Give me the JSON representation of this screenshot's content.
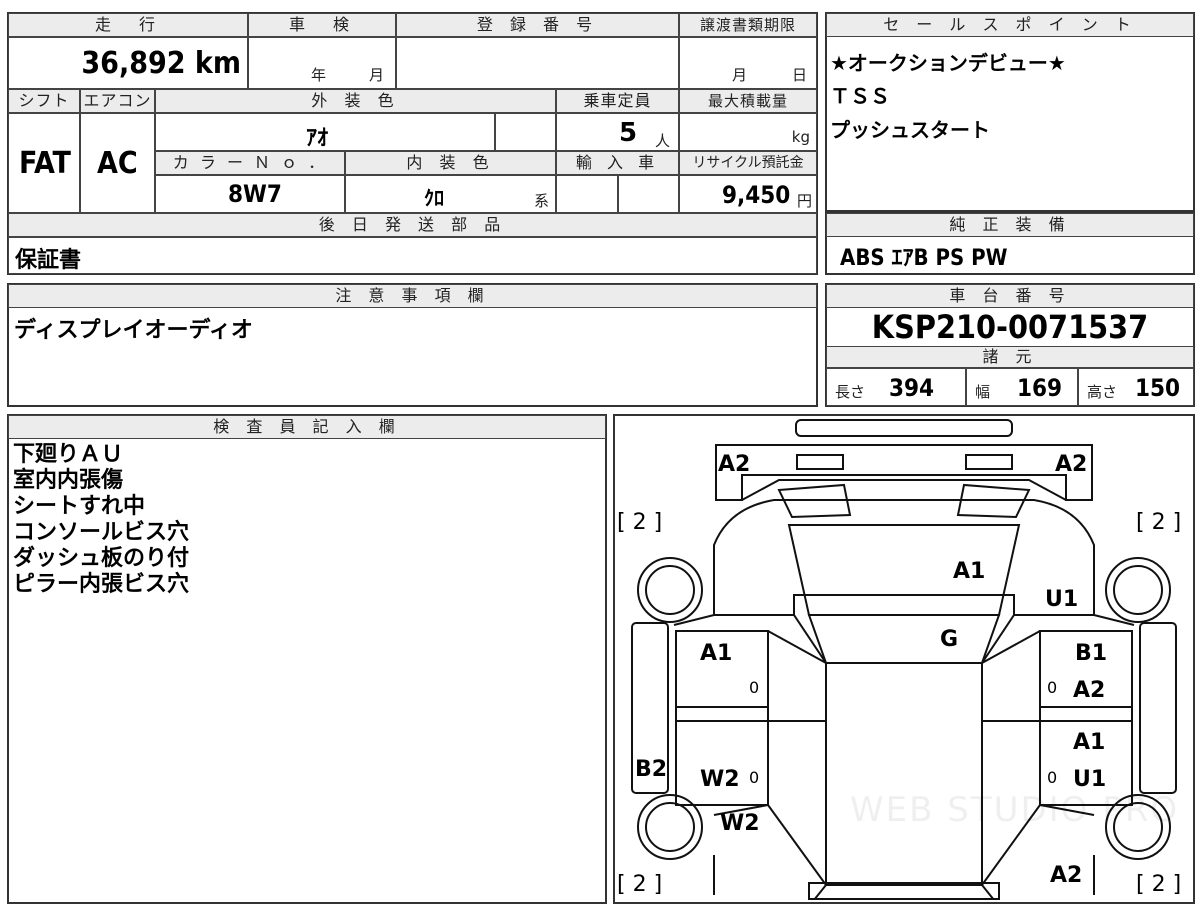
{
  "top": {
    "mileage_label": "走　行",
    "mileage": "36,892 km",
    "inspection_label": "車　検",
    "inspection_year": "年",
    "inspection_month": "月",
    "registration_label": "登 録 番 号",
    "transfer_label": "譲渡書類期限",
    "transfer_month": "月",
    "transfer_day": "日",
    "shift_label": "シフト",
    "ac_label": "エアコン",
    "shift": "FAT",
    "ac": "AC",
    "exterior_label": "外 装 色",
    "exterior_color": "ｱｵ",
    "capacity_label": "乗車定員",
    "capacity": "5",
    "capacity_unit": "人",
    "max_load_label": "最大積載量",
    "max_load_unit": "kg",
    "color_no_label": "カ ラ ー Ｎ ｏ ．",
    "color_no": "8W7",
    "interior_label": "内 装 色",
    "interior_color": "ｸﾛ",
    "interior_suffix": "系",
    "import_label": "輸 入 車",
    "recycle_label": "リサイクル預託金",
    "recycle_fee": "9,450",
    "recycle_unit": "円",
    "later_parts_label": "後 日 発 送 部 品",
    "later_parts": "保証書"
  },
  "sales": {
    "label": "セ ー ル ス ポ イ ン ト",
    "lines": [
      "★オークションデビュー★",
      "ＴＳＳ",
      "プッシュスタート"
    ]
  },
  "equipment": {
    "label": "純 正 装 備",
    "value": "ABS ｴｱB PS PW"
  },
  "notes": {
    "label": "注 意 事 項 欄",
    "value": "ディスプレイオーディオ"
  },
  "chassis": {
    "label": "車 台 番 号",
    "value": "KSP210-0071537",
    "spec_label": "諸 元",
    "length_label": "長さ",
    "length": "394",
    "width_label": "幅",
    "width": "169",
    "height_label": "高さ",
    "height": "150"
  },
  "inspector": {
    "label": "検 査 員 記 入 欄",
    "lines": [
      "下廻りＡＵ",
      "室内内張傷",
      "シートすれ中",
      "コンソールビス穴",
      "ダッシュ板のり付",
      "ピラー内張ビス穴"
    ]
  },
  "diagram": {
    "marks": {
      "front_left": "A2",
      "front_right": "A2",
      "tire_fl": "[ 2 ]",
      "tire_fr": "[ 2 ]",
      "tire_rl": "[ 2 ]",
      "tire_rr": "[ 2 ]",
      "hood": "A1",
      "fender_right": "U1",
      "glass": "G",
      "door_fl": "A1",
      "door_fr_1": "B1",
      "door_fr_2": "A2",
      "door_rr_1": "A1",
      "door_rr_2": "U1",
      "rocker_left": "B2",
      "door_rl": "W2",
      "quarter_left": "W2",
      "rear_right": "A2",
      "zero_1": "0",
      "zero_2": "0",
      "zero_3": "0",
      "zero_4": "0"
    },
    "watermark": "WEB STUDIO PRO"
  }
}
